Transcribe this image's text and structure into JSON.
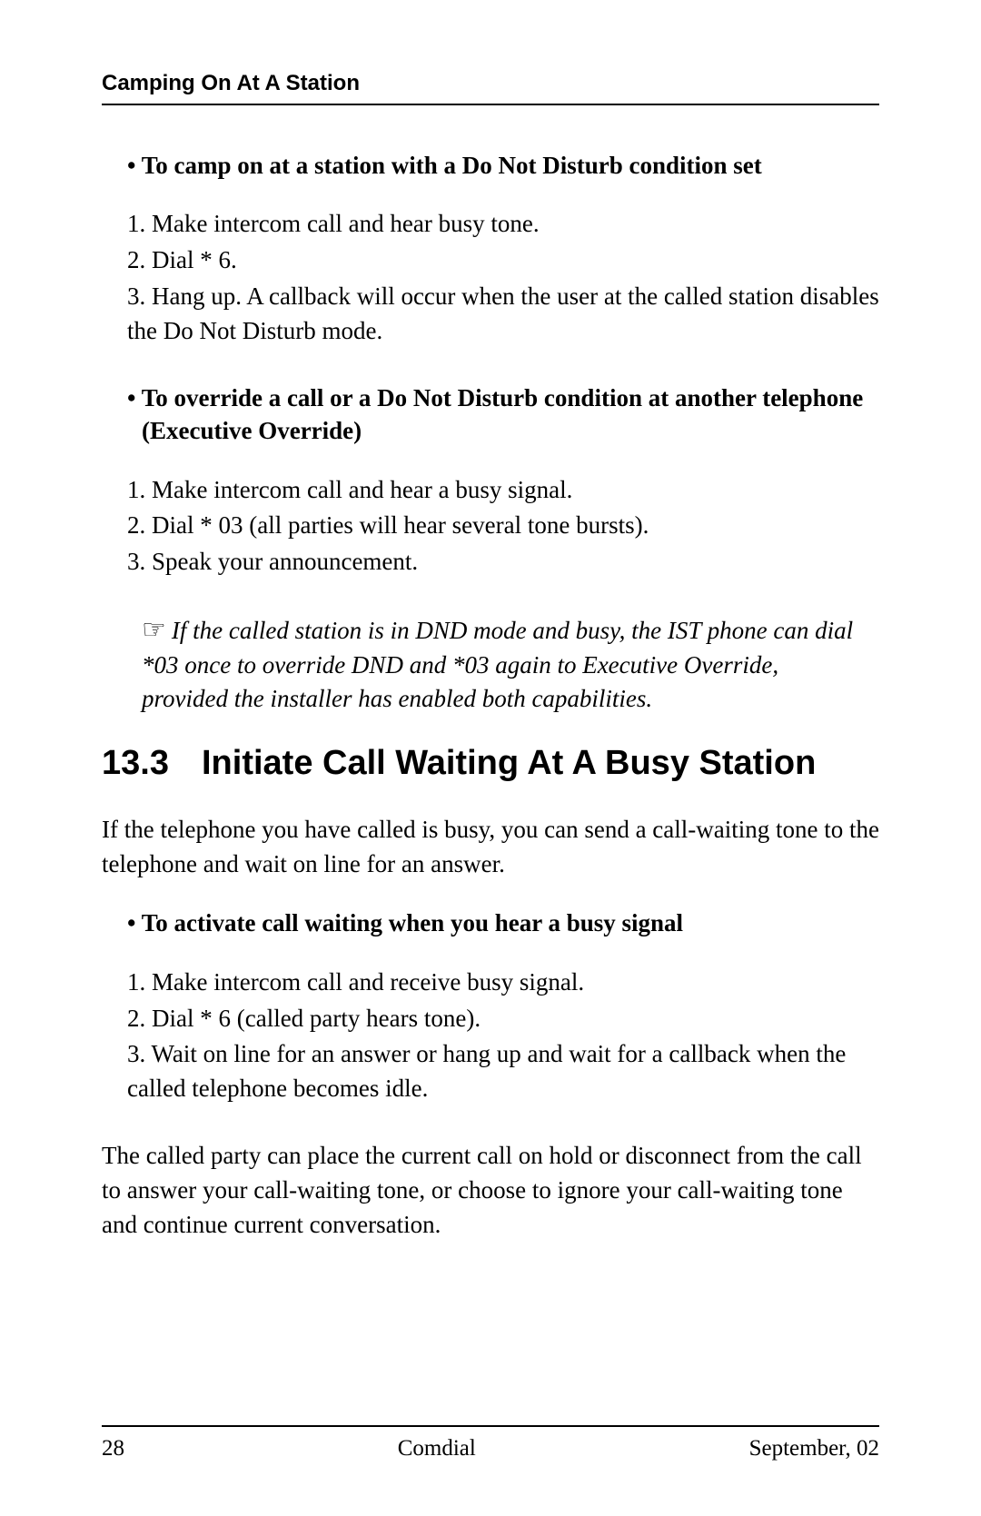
{
  "header": {
    "title": "Camping On At A Station"
  },
  "sections": {
    "sec1": {
      "title": "• To camp on at a station with a Do Not Disturb condition set",
      "steps": [
        "1.  Make intercom call and hear busy tone.",
        "2.  Dial * 6.",
        "3.  Hang up. A callback will occur when the user at the called station disables the Do Not Disturb mode."
      ]
    },
    "sec2": {
      "title": "• To override a call or a Do Not Disturb condition at another telephone (Executive Override)",
      "steps": [
        "1.  Make intercom call and hear a busy signal.",
        "2.  Dial * 03 (all parties will hear several tone bursts).",
        "3.  Speak your announcement."
      ],
      "note": "If the called station is in DND mode and busy, the IST phone can dial *03 once to override DND and *03 again to Executive Override, provided the installer has enabled both capabilities."
    },
    "sec3": {
      "number": "13.3",
      "title": "Initiate Call Waiting At A Busy Station",
      "intro": "If the telephone you have called is busy, you can send a call-waiting tone to the telephone and wait on line for an answer.",
      "procTitle": "• To activate call waiting when you hear a busy signal",
      "steps": [
        "1.  Make intercom call and receive busy signal.",
        "2.  Dial * 6 (called party hears tone).",
        "3.  Wait on line for an answer or hang up and wait for a callback when the called telephone becomes idle."
      ],
      "closing": "The called party can place the current call on hold or disconnect from the call to answer your call-waiting tone, or choose to ignore your call-waiting tone and continue current conversation."
    }
  },
  "footer": {
    "page": "28",
    "center": "Comdial",
    "right": "September, 02"
  }
}
